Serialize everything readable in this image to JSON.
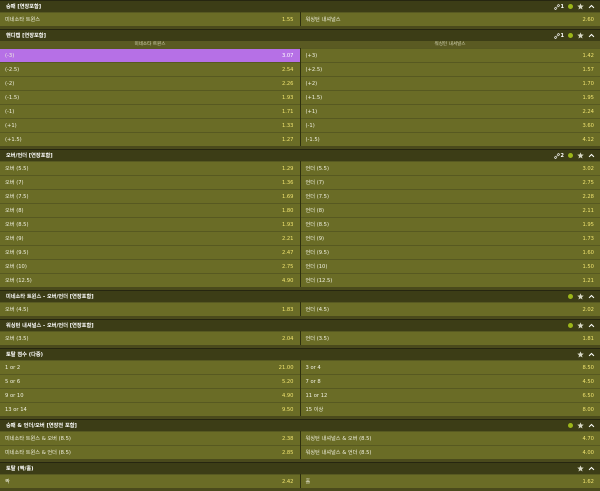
{
  "sections": [
    {
      "title": "승패 [연장포함]",
      "link_count": "1",
      "has_link": true,
      "has_dot": true,
      "rows": [
        [
          {
            "label": "미네소타 트윈스",
            "value": "1.55"
          },
          {
            "label": "워싱턴 내셔널스",
            "value": "2.60"
          }
        ]
      ]
    },
    {
      "title": "핸디캡 [연장포함]",
      "link_count": "1",
      "has_link": true,
      "has_dot": true,
      "subheader": [
        "미네소타 트윈스",
        "워싱턴 내셔널스"
      ],
      "rows": [
        [
          {
            "label": "(-3)",
            "value": "3.07",
            "selected": true
          },
          {
            "label": "(+3)",
            "value": "1.42"
          }
        ],
        [
          {
            "label": "(-2.5)",
            "value": "2.54"
          },
          {
            "label": "(+2.5)",
            "value": "1.57"
          }
        ],
        [
          {
            "label": "(-2)",
            "value": "2.26"
          },
          {
            "label": "(+2)",
            "value": "1.70"
          }
        ],
        [
          {
            "label": "(-1.5)",
            "value": "1.93"
          },
          {
            "label": "(+1.5)",
            "value": "1.95"
          }
        ],
        [
          {
            "label": "(-1)",
            "value": "1.71"
          },
          {
            "label": "(+1)",
            "value": "2.24"
          }
        ],
        [
          {
            "label": "(+1)",
            "value": "1.33"
          },
          {
            "label": "(-1)",
            "value": "3.60"
          }
        ],
        [
          {
            "label": "(+1.5)",
            "value": "1.27"
          },
          {
            "label": "(-1.5)",
            "value": "4.12"
          }
        ]
      ]
    },
    {
      "title": "오버/언더 [연장포함]",
      "link_count": "2",
      "has_link": true,
      "has_dot": true,
      "rows": [
        [
          {
            "label": "오버 (5.5)",
            "value": "1.29"
          },
          {
            "label": "언더 (5.5)",
            "value": "3.02"
          }
        ],
        [
          {
            "label": "오버 (7)",
            "value": "1.36"
          },
          {
            "label": "언더 (7)",
            "value": "2.75"
          }
        ],
        [
          {
            "label": "오버 (7.5)",
            "value": "1.69"
          },
          {
            "label": "언더 (7.5)",
            "value": "2.28"
          }
        ],
        [
          {
            "label": "오버 (8)",
            "value": "1.80"
          },
          {
            "label": "언더 (8)",
            "value": "2.11"
          }
        ],
        [
          {
            "label": "오버 (8.5)",
            "value": "1.93"
          },
          {
            "label": "언더 (8.5)",
            "value": "1.95"
          }
        ],
        [
          {
            "label": "오버 (9)",
            "value": "2.21"
          },
          {
            "label": "언더 (9)",
            "value": "1.73"
          }
        ],
        [
          {
            "label": "오버 (9.5)",
            "value": "2.47"
          },
          {
            "label": "언더 (9.5)",
            "value": "1.60"
          }
        ],
        [
          {
            "label": "오버 (10)",
            "value": "2.75"
          },
          {
            "label": "언더 (10)",
            "value": "1.50"
          }
        ],
        [
          {
            "label": "오버 (12.5)",
            "value": "4.90"
          },
          {
            "label": "언더 (12.5)",
            "value": "1.21"
          }
        ]
      ]
    },
    {
      "title": "미네소타 트윈스 - 오버/언더 [연장포함]",
      "has_link": false,
      "has_dot": true,
      "rows": [
        [
          {
            "label": "오버 (4.5)",
            "value": "1.83"
          },
          {
            "label": "언더 (4.5)",
            "value": "2.02"
          }
        ]
      ]
    },
    {
      "title": "워싱턴 내셔널스 - 오버/언더 [연장포함]",
      "has_link": false,
      "has_dot": true,
      "rows": [
        [
          {
            "label": "오버 (3.5)",
            "value": "2.04"
          },
          {
            "label": "언더 (3.5)",
            "value": "1.81"
          }
        ]
      ]
    },
    {
      "title": "토탈 점수 (다중)",
      "has_link": false,
      "has_dot": false,
      "rows": [
        [
          {
            "label": "1 or 2",
            "value": "21.00"
          },
          {
            "label": "3 or 4",
            "value": "8.50"
          }
        ],
        [
          {
            "label": "5 or 6",
            "value": "5.20"
          },
          {
            "label": "7 or 8",
            "value": "4.50"
          }
        ],
        [
          {
            "label": "9 or 10",
            "value": "4.90"
          },
          {
            "label": "11 or 12",
            "value": "6.50"
          }
        ],
        [
          {
            "label": "13 or 14",
            "value": "9.50"
          },
          {
            "label": "15 이상",
            "value": "8.00"
          }
        ]
      ]
    },
    {
      "title": "승패 & 언더/오버 [연장전 포함]",
      "has_link": false,
      "has_dot": true,
      "rows": [
        [
          {
            "label": "미네소타 트윈스 & 오버 (8.5)",
            "value": "2.38"
          },
          {
            "label": "워싱턴 내셔널스 & 오버 (8.5)",
            "value": "4.70"
          }
        ],
        [
          {
            "label": "미네소타 트윈스 & 언더 (8.5)",
            "value": "2.85"
          },
          {
            "label": "워싱턴 내셔널스 & 언더 (8.5)",
            "value": "4.00"
          }
        ]
      ]
    },
    {
      "title": "토탈 (짝/홀)",
      "has_link": false,
      "has_dot": false,
      "rows": [
        [
          {
            "label": "짝",
            "value": "2.42"
          },
          {
            "label": "홀",
            "value": "1.62"
          }
        ]
      ]
    }
  ]
}
